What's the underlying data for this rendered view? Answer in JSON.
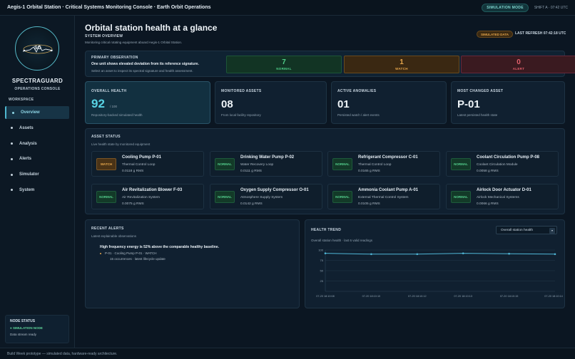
{
  "topbar": {
    "title": "Aegis-1 Orbital Station · Critical Systems Monitoring Console · Earth Orbit Operations",
    "mode_badge": "SIMULATION MODE",
    "shift": "SHIFT A · 07:42 UTC"
  },
  "sidebar": {
    "logo_text": "SG",
    "brand": "SPECTRAGUARD",
    "brand_sub": "OPERATIONS CONSOLE",
    "workspace_label": "WORKSPACE",
    "items": [
      {
        "label": "Overview",
        "active": true
      },
      {
        "label": "Assets",
        "active": false
      },
      {
        "label": "Analysis",
        "active": false
      },
      {
        "label": "Alerts",
        "active": false
      },
      {
        "label": "Simulator",
        "active": false
      },
      {
        "label": "System",
        "active": false
      }
    ],
    "node_status": {
      "title": "NODE STATUS",
      "state": "● SIMULATION NODE",
      "detail": "Data stream ready"
    }
  },
  "header": {
    "title": "Orbital station health at a glance",
    "section": "SYSTEM OVERVIEW",
    "description": "Monitoring critical rotating equipment aboard Aegis-1 Orbital Station.",
    "sim_badge": "SIMULATED DATA",
    "last_refresh": "LAST REFRESH  07:42:18 UTC"
  },
  "observation": {
    "title": "PRIMARY OBSERVATION",
    "message": "One unit shows elevated deviation from its reference signature.",
    "hint": "Select an asset to inspect its spectral signature and health assessment.",
    "counts": [
      {
        "value": "7",
        "label": "NORMAL"
      },
      {
        "value": "1",
        "label": "WATCH"
      },
      {
        "value": "0",
        "label": "ALERT"
      }
    ]
  },
  "kpis": {
    "overall": {
      "title": "OVERALL HEALTH",
      "value": "92",
      "max": "/ 100",
      "desc": "Repository-backed simulated health"
    },
    "monitored": {
      "title": "MONITORED ASSETS",
      "value": "08",
      "desc": "From local facility repository"
    },
    "anomalies": {
      "title": "ACTIVE ANOMALIES",
      "value": "01",
      "desc": "Persisted watch / alert events"
    },
    "changed": {
      "title": "MOST CHANGED ASSET",
      "value": "P-01",
      "desc": "Latest persisted health state"
    }
  },
  "asset_status": {
    "title": "ASSET STATUS",
    "subtitle": "Live health state by monitored equipment",
    "assets": [
      {
        "badge": "WATCH",
        "status": "watch",
        "name": "Cooling Pump P-01",
        "system": "Thermal Control Loop",
        "rms": "0.0118 g RMS"
      },
      {
        "badge": "NORMAL",
        "status": "normal",
        "name": "Drinking Water Pump P-02",
        "system": "Water Recovery Loop",
        "rms": "0.0111 g RMS"
      },
      {
        "badge": "NORMAL",
        "status": "normal",
        "name": "Refrigerant Compressor C-01",
        "system": "Thermal Control Loop",
        "rms": "0.0165 g RMS"
      },
      {
        "badge": "NORMAL",
        "status": "normal",
        "name": "Coolant Circulation Pump P-08",
        "system": "Coolant Circulation Module",
        "rms": "0.0058 g RMS"
      },
      {
        "badge": "NORMAL",
        "status": "normal",
        "name": "Air Revitalization Blower F-03",
        "system": "Air Revitalization System",
        "rms": "0.0075 g RMS"
      },
      {
        "badge": "NORMAL",
        "status": "normal",
        "name": "Oxygen Supply Compressor O-01",
        "system": "Atmosphere Supply System",
        "rms": "0.0142 g RMS"
      },
      {
        "badge": "NORMAL",
        "status": "normal",
        "name": "Ammonia Coolant Pump A-01",
        "system": "External Thermal Control System",
        "rms": "0.0105 g RMS"
      },
      {
        "badge": "NORMAL",
        "status": "normal",
        "name": "Airlock Door Actuator D-01",
        "system": "Airlock Mechanical Systems",
        "rms": "0.0066 g RMS"
      }
    ]
  },
  "recent_alerts": {
    "title": "RECENT ALERTS",
    "subtitle": "Latest explainable observations",
    "message": "High frequency energy is 52% above the comparable healthy baseline.",
    "line": "P-01 · Cooling Pump P-01 · WATCH",
    "occurrences": "15 occurrences · latest lifecycle update"
  },
  "health_trend": {
    "title": "HEALTH TREND",
    "subtitle": "Overall station health · last 6 valid readings",
    "select_value": "Overall station health"
  },
  "chart_data": {
    "type": "line",
    "x": [
      "07-20 18:10:08",
      "07-20 18:10:10",
      "07-20 18:10:12",
      "07-20 18:10:13",
      "07-20 18:10:15",
      "07-20 18:10:14"
    ],
    "y": [
      92,
      90,
      90,
      92,
      91,
      90
    ],
    "yticks": [
      25,
      50,
      75,
      100
    ],
    "ylim": [
      0,
      100
    ],
    "grid": true,
    "line_color": "#4fb6d6"
  },
  "footer": {
    "text": "Build Week prototype — simulated data, hardware-ready architecture."
  }
}
